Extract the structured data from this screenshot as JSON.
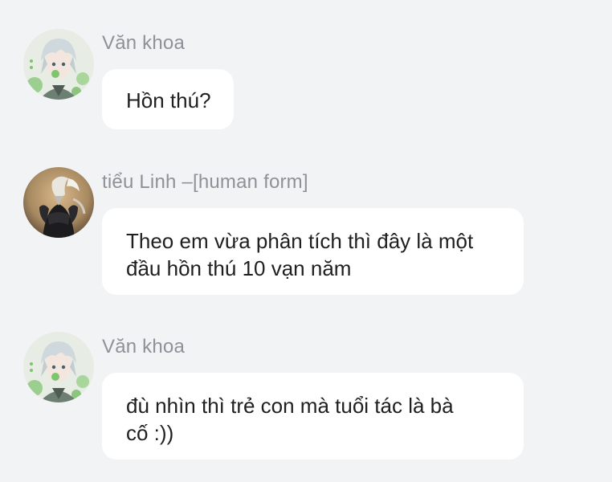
{
  "messages": [
    {
      "sender": "Văn khoa",
      "avatar_icon": "anime-boy-avatar-icon",
      "lines": [
        "Hồn thú?"
      ]
    },
    {
      "sender": "tiểu Linh –[human form]",
      "avatar_icon": "dark-armored-creature-avatar-icon",
      "lines": [
        "Theo em vừa phân tích thì đây là một",
        "đầu hồn thú 10 vạn năm"
      ]
    },
    {
      "sender": "Văn khoa",
      "avatar_icon": "anime-boy-avatar-icon",
      "lines": [
        "đù nhìn thì trẻ con mà tuổi tác là bà",
        "cố :))"
      ]
    }
  ],
  "colors": {
    "background": "#f2f3f5",
    "bubble": "#ffffff",
    "sender_text": "#8e9197",
    "message_text": "#1f1f1f"
  }
}
